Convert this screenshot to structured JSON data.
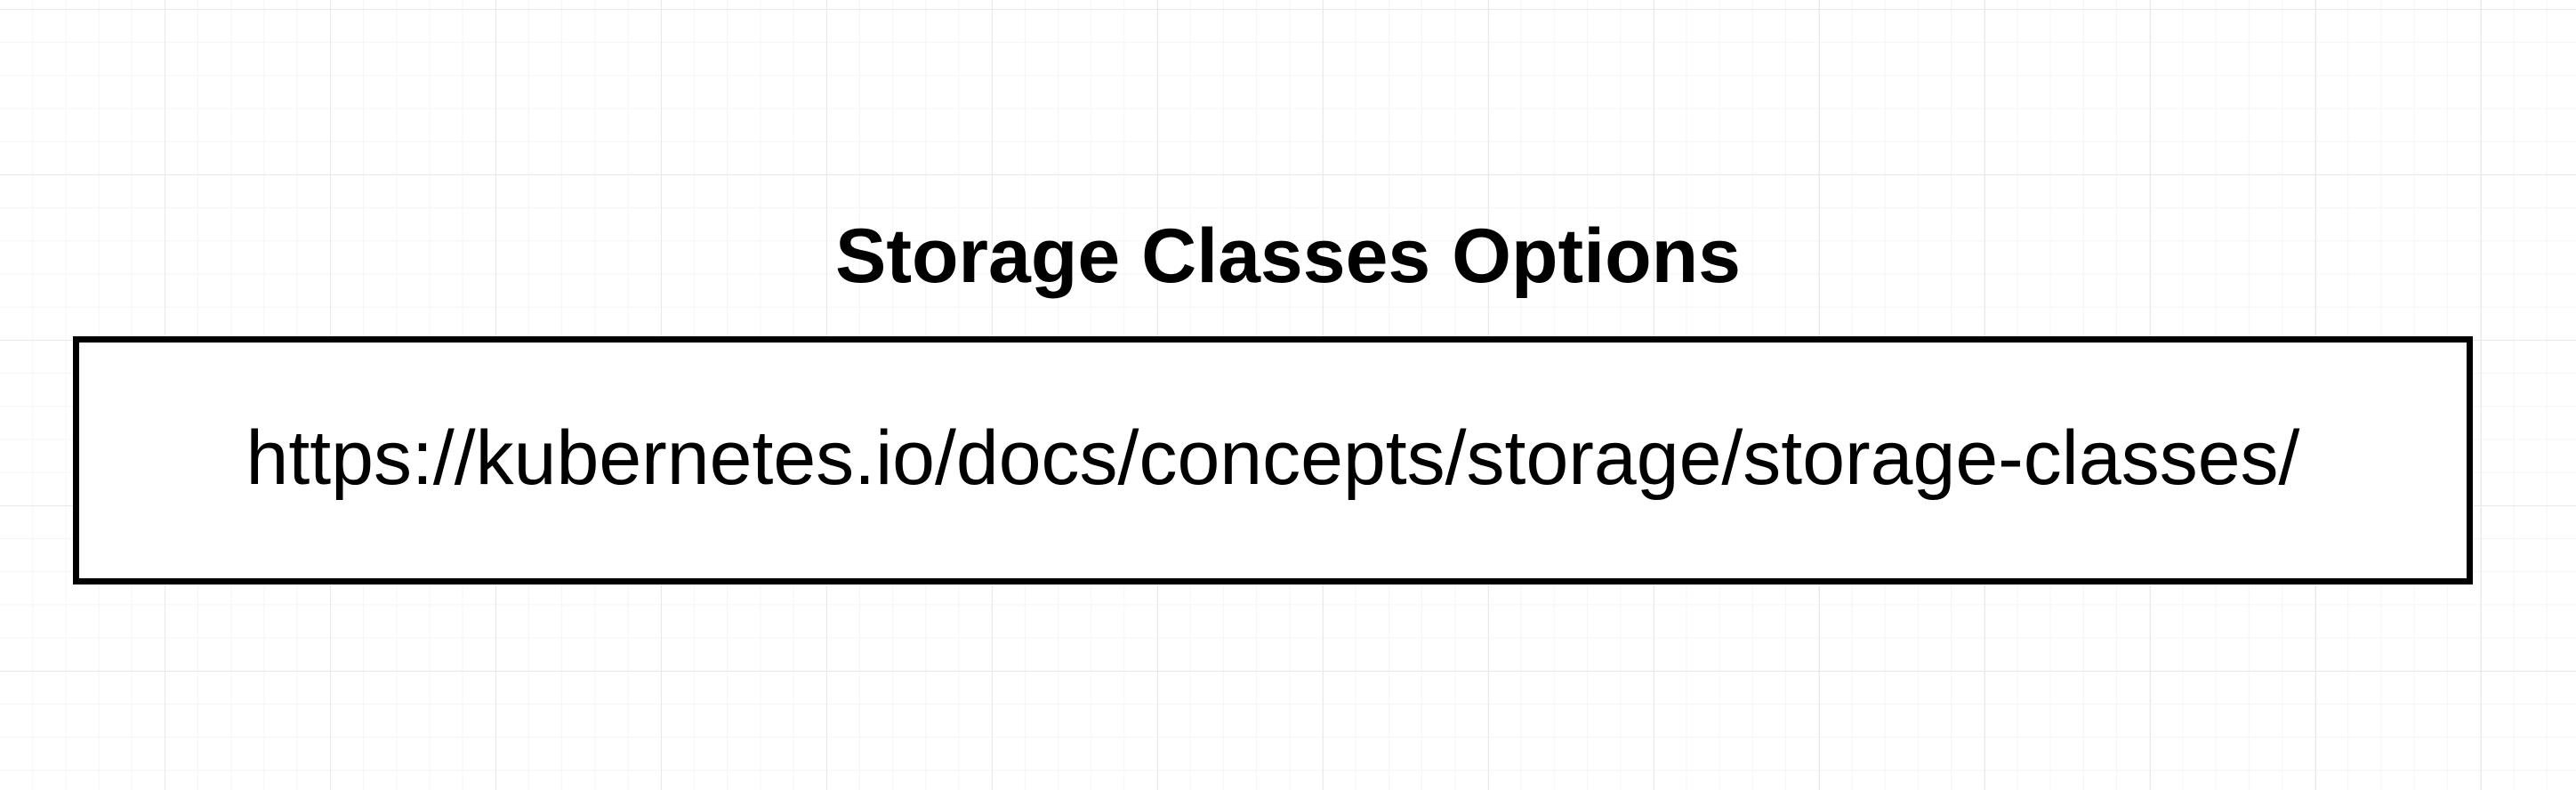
{
  "diagram": {
    "title": "Storage Classes Options",
    "url_box": {
      "text": "https://kubernetes.io/docs/concepts/storage/storage-classes/"
    }
  },
  "colors": {
    "background": "#ffffff",
    "grid_major": "#e9e9e9",
    "grid_minor": "#f5f5f5",
    "text": "#000000",
    "border": "#000000"
  }
}
